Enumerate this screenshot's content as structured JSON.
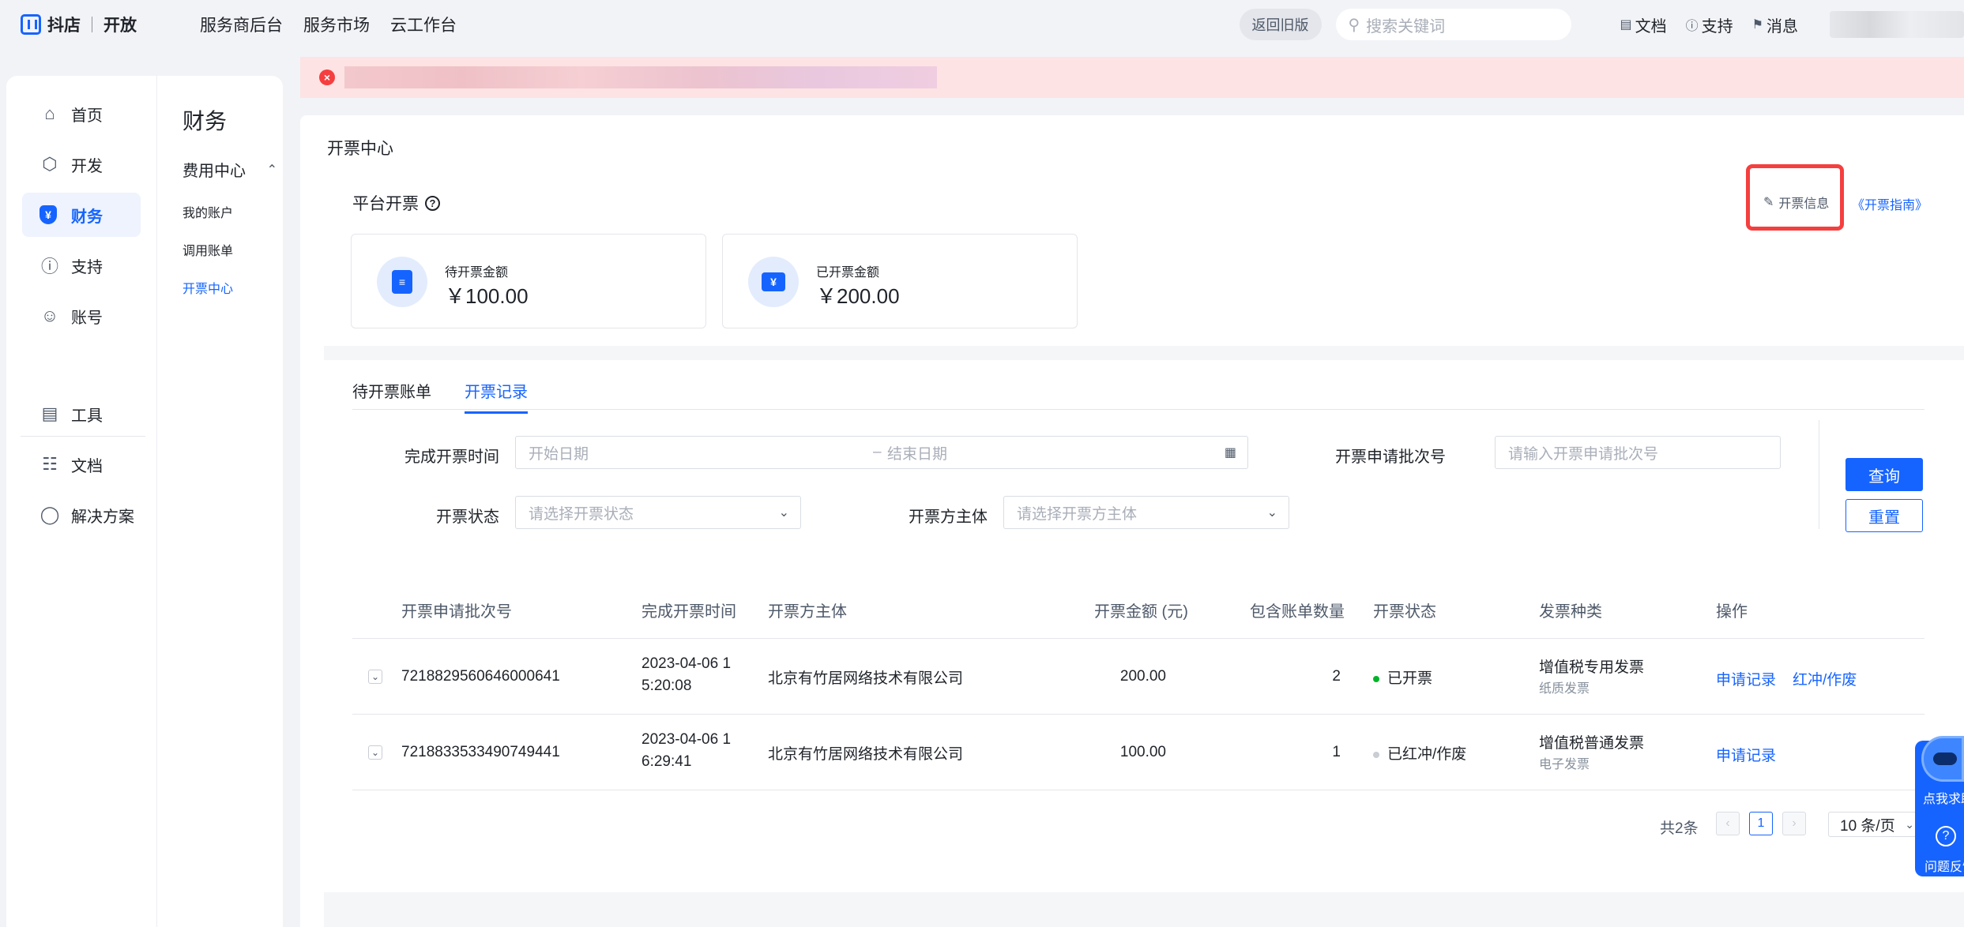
{
  "topnav": {
    "brand": "抖店",
    "brand_sub": "开放",
    "menu": [
      "服务商后台",
      "服务市场",
      "云工作台"
    ],
    "old_version": "返回旧版",
    "search_placeholder": "搜索关键词",
    "links": [
      "文档",
      "支持",
      "消息"
    ]
  },
  "sidebar": {
    "items": [
      {
        "label": "首页",
        "icon": "home-icon"
      },
      {
        "label": "开发",
        "icon": "cube-icon"
      },
      {
        "label": "财务",
        "icon": "finance-icon"
      },
      {
        "label": "支持",
        "icon": "info-icon"
      },
      {
        "label": "账号",
        "icon": "user-icon"
      },
      {
        "label": "工具",
        "icon": "toolbox-icon"
      },
      {
        "label": "文档",
        "icon": "document-icon"
      },
      {
        "label": "解决方案",
        "icon": "bulb-icon"
      }
    ],
    "active": "财务"
  },
  "subnav": {
    "title": "财务",
    "group": "费用中心",
    "items": [
      "我的账户",
      "调用账单",
      "开票中心"
    ],
    "active": "开票中心"
  },
  "main": {
    "page_title": "开票中心",
    "section_title": "平台开票",
    "invoice_info": "开票信息",
    "invoice_guide": "《开票指南》",
    "stats": [
      {
        "label": "待开票金额",
        "value": "￥100.00"
      },
      {
        "label": "已开票金额",
        "value": "￥200.00"
      }
    ],
    "tabs": [
      "待开票账单",
      "开票记录"
    ],
    "active_tab": "开票记录",
    "filters": {
      "time_label": "完成开票时间",
      "start_placeholder": "开始日期",
      "range_sep": "–",
      "end_placeholder": "结束日期",
      "batch_label": "开票申请批次号",
      "batch_placeholder": "请输入开票申请批次号",
      "status_label": "开票状态",
      "status_placeholder": "请选择开票状态",
      "entity_label": "开票方主体",
      "entity_placeholder": "请选择开票方主体",
      "query": "查询",
      "reset": "重置"
    },
    "table": {
      "columns": [
        "开票申请批次号",
        "完成开票时间",
        "开票方主体",
        "开票金额 (元)",
        "包含账单数量",
        "开票状态",
        "发票种类",
        "操作"
      ],
      "rows": [
        {
          "batch": "7218829560646000641",
          "time_1": "2023-04-06 1",
          "time_2": "5:20:08",
          "entity": "北京有竹居网络技术有限公司",
          "amount": "200.00",
          "count": "2",
          "status": "已开票",
          "status_color": "#00b42a",
          "kind": "增值税专用发票",
          "kind_sub": "纸质发票",
          "action_1": "申请记录",
          "action_2": "红冲/作废"
        },
        {
          "batch": "7218833533490749441",
          "time_1": "2023-04-06 1",
          "time_2": "6:29:41",
          "entity": "北京有竹居网络技术有限公司",
          "amount": "100.00",
          "count": "1",
          "status": "已红冲/作废",
          "status_color": "#c9cdd4",
          "kind": "增值税普通发票",
          "kind_sub": "电子发票",
          "action_1": "申请记录"
        }
      ]
    },
    "pagination": {
      "total": "共2条",
      "prev": "‹",
      "current": "1",
      "next": "›",
      "page_size": "10 条/页"
    }
  },
  "helper": {
    "ask": "点我求助",
    "feedback": "问题反馈"
  }
}
